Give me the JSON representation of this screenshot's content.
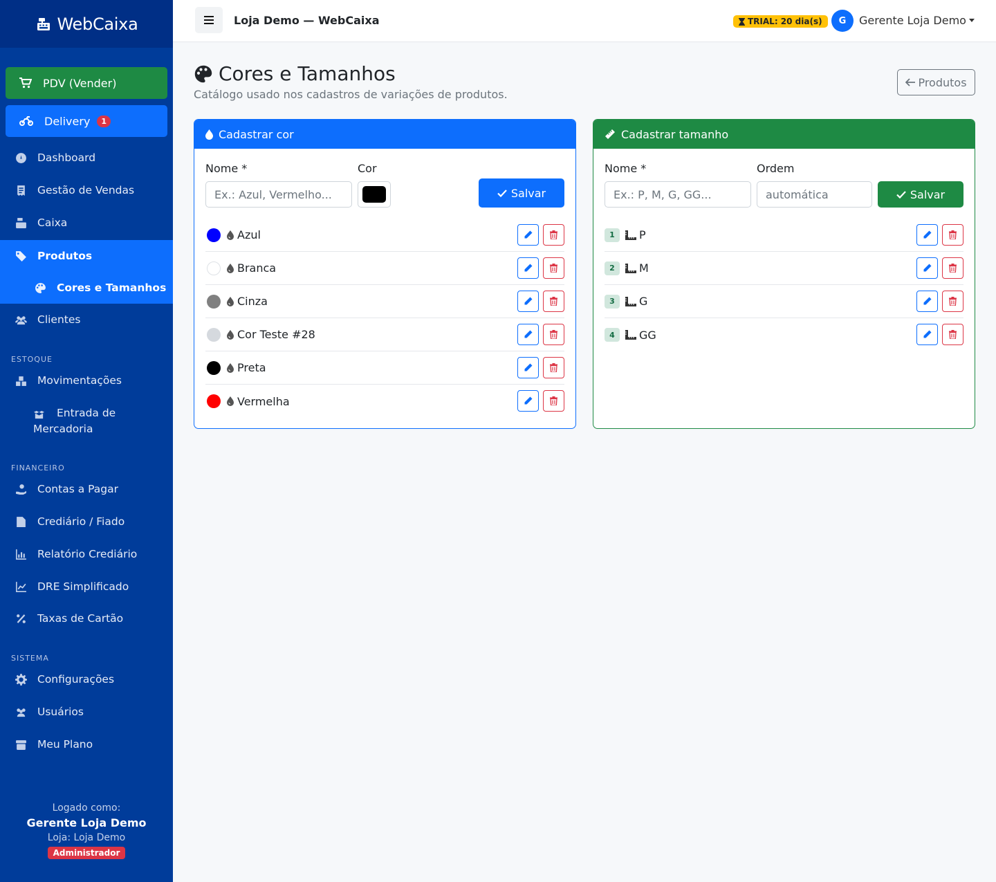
{
  "app": {
    "brand": "WebCaixa",
    "store_title": "Loja Demo — WebCaixa",
    "trial": "TRIAL: 20 dia(s)",
    "user_initial": "G",
    "user_name": "Gerente Loja Demo"
  },
  "sidebar": {
    "pdv": "PDV (Vender)",
    "delivery": "Delivery",
    "delivery_count": "1",
    "dashboard": "Dashboard",
    "vendas": "Gestão de Vendas",
    "caixa": "Caixa",
    "produtos": "Produtos",
    "cores": "Cores e Tamanhos",
    "clientes": "Clientes",
    "sec_estoque": "ESTOQUE",
    "movimentacoes": "Movimentações",
    "entrada_l1": "Entrada de",
    "entrada_l2": "Mercadoria",
    "sec_financeiro": "FINANCEIRO",
    "contas": "Contas a Pagar",
    "crediario": "Crediário / Fiado",
    "relatorio": "Relatório Crediário",
    "dre": "DRE Simplificado",
    "taxas": "Taxas de Cartão",
    "sec_sistema": "SISTEMA",
    "config": "Configurações",
    "usuarios": "Usuários",
    "plano": "Meu Plano",
    "logged_as": "Logado como:",
    "logged_user": "Gerente Loja Demo",
    "logged_store": "Loja: Loja Demo",
    "role": "Administrador"
  },
  "page": {
    "title": "Cores e Tamanhos",
    "subtitle": "Catálogo usado nos cadastros de variações de produtos.",
    "back": "Produtos"
  },
  "colors_card": {
    "header": "Cadastrar cor",
    "name_label": "Nome *",
    "color_label": "Cor",
    "name_placeholder": "Ex.: Azul, Vermelho...",
    "save": "Salvar",
    "items": [
      {
        "name": "Azul",
        "hex": "#0000ff"
      },
      {
        "name": "Branca",
        "hex": "#ffffff"
      },
      {
        "name": "Cinza",
        "hex": "#808080"
      },
      {
        "name": "Cor Teste #28",
        "hex": "#d5d9de"
      },
      {
        "name": "Preta",
        "hex": "#000000"
      },
      {
        "name": "Vermelha",
        "hex": "#ff0000"
      }
    ]
  },
  "sizes_card": {
    "header": "Cadastrar tamanho",
    "name_label": "Nome *",
    "order_label": "Ordem",
    "name_placeholder": "Ex.: P, M, G, GG...",
    "order_placeholder": "automática",
    "save": "Salvar",
    "items": [
      {
        "order": "1",
        "name": "P"
      },
      {
        "order": "2",
        "name": "M"
      },
      {
        "order": "3",
        "name": "G"
      },
      {
        "order": "4",
        "name": "GG"
      }
    ]
  }
}
